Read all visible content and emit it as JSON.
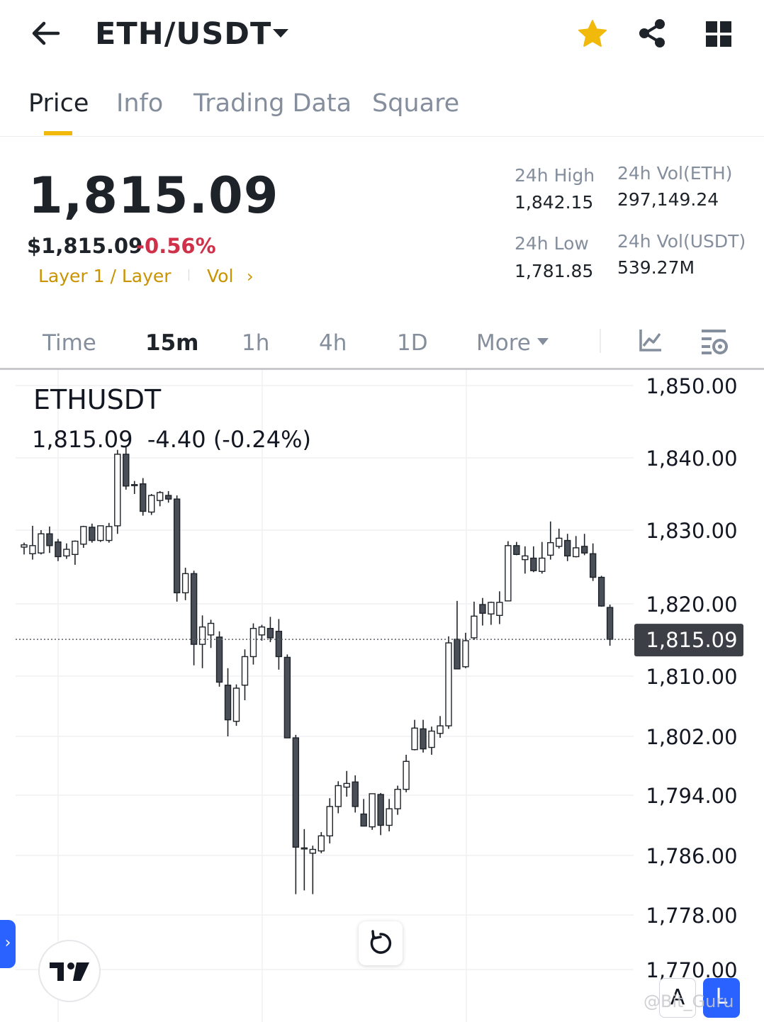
{
  "header": {
    "pair": "ETH/USDT",
    "icons": [
      "back-arrow-icon",
      "caret-down-icon",
      "star-icon",
      "share-icon",
      "grid-icon"
    ],
    "favorite_color": "#f0b90b"
  },
  "tabs": [
    {
      "label": "Price",
      "active": true
    },
    {
      "label": "Info",
      "active": false
    },
    {
      "label": "Trading Data",
      "active": false
    },
    {
      "label": "Square",
      "active": false
    }
  ],
  "ticker": {
    "last_price": "1,815.09",
    "usd_price": "$1,815.09",
    "change_pct": "-0.56%",
    "tag": "Layer 1 / Layer",
    "vol_link": "Vol",
    "vol_arrow": "›",
    "high_label": "24h High",
    "high_value": "1,842.15",
    "low_label": "24h Low",
    "low_value": "1,781.85",
    "vol_eth_label": "24h Vol(ETH)",
    "vol_eth_value": "297,149.24",
    "vol_usdt_label": "24h Vol(USDT)",
    "vol_usdt_value": "539.27M",
    "colors": {
      "down": "#cf304a",
      "accent": "#f0b90b",
      "tag": "#c99400"
    }
  },
  "intervals": [
    {
      "label": "Time",
      "active": false
    },
    {
      "label": "15m",
      "active": true
    },
    {
      "label": "1h",
      "active": false
    },
    {
      "label": "4h",
      "active": false
    },
    {
      "label": "1D",
      "active": false
    },
    {
      "label": "More",
      "active": false
    }
  ],
  "chart": {
    "symbol": "ETHUSDT",
    "quote": "1,815.09  -4.40 (-0.24%)",
    "drawer_arrow": "›",
    "auto_label": "A",
    "log_label": "L",
    "watermark": "@Bit_Guru"
  },
  "chart_data": {
    "type": "candlestick",
    "symbol": "ETHUSDT",
    "interval": "15m",
    "y_ticks": [
      "1,850.00",
      "1,840.00",
      "1,830.00",
      "1,820.00",
      "1,810.00",
      "1,802.00",
      "1,794.00",
      "1,786.00",
      "1,778.00",
      "1,770.00"
    ],
    "y_tick_values": [
      1850,
      1840,
      1830,
      1820,
      1810,
      1802,
      1794,
      1786,
      1778,
      1770
    ],
    "ylim": [
      1766,
      1851.5
    ],
    "last_price_label": "1,815.09",
    "last_price": 1815.09,
    "candles": [
      {
        "o": 1827.7,
        "h": 1828.3,
        "l": 1826.7,
        "c": 1828.0
      },
      {
        "o": 1826.8,
        "h": 1830.6,
        "l": 1826.0,
        "c": 1827.9
      },
      {
        "o": 1826.9,
        "h": 1830.0,
        "l": 1826.7,
        "c": 1829.5
      },
      {
        "o": 1829.5,
        "h": 1830.5,
        "l": 1826.9,
        "c": 1827.9
      },
      {
        "o": 1828.4,
        "h": 1828.8,
        "l": 1825.8,
        "c": 1826.4
      },
      {
        "o": 1826.5,
        "h": 1828.2,
        "l": 1826.1,
        "c": 1827.4
      },
      {
        "o": 1826.7,
        "h": 1828.6,
        "l": 1825.3,
        "c": 1828.5
      },
      {
        "o": 1828.1,
        "h": 1830.6,
        "l": 1827.6,
        "c": 1830.5
      },
      {
        "o": 1830.4,
        "h": 1830.9,
        "l": 1828.3,
        "c": 1828.6
      },
      {
        "o": 1828.6,
        "h": 1830.5,
        "l": 1828.4,
        "c": 1830.6
      },
      {
        "o": 1828.6,
        "h": 1831.0,
        "l": 1828.3,
        "c": 1830.5
      },
      {
        "o": 1830.6,
        "h": 1841.1,
        "l": 1829.5,
        "c": 1840.5
      },
      {
        "o": 1840.5,
        "h": 1841.5,
        "l": 1835.6,
        "c": 1836.1
      },
      {
        "o": 1836.2,
        "h": 1836.8,
        "l": 1835.0,
        "c": 1836.3
      },
      {
        "o": 1836.4,
        "h": 1837.2,
        "l": 1832.0,
        "c": 1832.6
      },
      {
        "o": 1832.5,
        "h": 1835.0,
        "l": 1832.1,
        "c": 1834.8
      },
      {
        "o": 1834.1,
        "h": 1835.4,
        "l": 1833.3,
        "c": 1835.2
      },
      {
        "o": 1834.8,
        "h": 1835.4,
        "l": 1833.8,
        "c": 1834.3
      },
      {
        "o": 1834.3,
        "h": 1834.8,
        "l": 1820.3,
        "c": 1821.5
      },
      {
        "o": 1821.5,
        "h": 1824.9,
        "l": 1820.5,
        "c": 1824.1
      },
      {
        "o": 1824.1,
        "h": 1824.5,
        "l": 1811.5,
        "c": 1814.4
      },
      {
        "o": 1814.4,
        "h": 1818.4,
        "l": 1811.1,
        "c": 1816.8
      },
      {
        "o": 1815.7,
        "h": 1817.8,
        "l": 1813.9,
        "c": 1817.3
      },
      {
        "o": 1815.4,
        "h": 1816.2,
        "l": 1808.6,
        "c": 1809.2
      },
      {
        "o": 1808.8,
        "h": 1811.1,
        "l": 1802.0,
        "c": 1804.2
      },
      {
        "o": 1804.0,
        "h": 1808.9,
        "l": 1803.4,
        "c": 1808.4
      },
      {
        "o": 1808.8,
        "h": 1813.7,
        "l": 1806.8,
        "c": 1812.7
      },
      {
        "o": 1812.7,
        "h": 1817.3,
        "l": 1811.6,
        "c": 1816.6
      },
      {
        "o": 1815.7,
        "h": 1817.1,
        "l": 1814.9,
        "c": 1816.8
      },
      {
        "o": 1816.6,
        "h": 1818.2,
        "l": 1814.7,
        "c": 1815.3
      },
      {
        "o": 1816.2,
        "h": 1817.9,
        "l": 1810.9,
        "c": 1812.7
      },
      {
        "o": 1812.6,
        "h": 1813.0,
        "l": 1801.8,
        "c": 1801.8
      },
      {
        "o": 1801.8,
        "h": 1802.2,
        "l": 1780.8,
        "c": 1787.1
      },
      {
        "o": 1787.0,
        "h": 1789.5,
        "l": 1781.3,
        "c": 1787.0
      },
      {
        "o": 1786.3,
        "h": 1787.3,
        "l": 1780.8,
        "c": 1786.8
      },
      {
        "o": 1786.6,
        "h": 1789.1,
        "l": 1786.3,
        "c": 1788.6
      },
      {
        "o": 1788.6,
        "h": 1793.6,
        "l": 1787.6,
        "c": 1792.5
      },
      {
        "o": 1792.5,
        "h": 1795.9,
        "l": 1791.6,
        "c": 1795.3
      },
      {
        "o": 1795.1,
        "h": 1797.3,
        "l": 1793.8,
        "c": 1795.6
      },
      {
        "o": 1795.8,
        "h": 1796.7,
        "l": 1791.7,
        "c": 1792.5
      },
      {
        "o": 1791.5,
        "h": 1793.5,
        "l": 1789.9,
        "c": 1789.9
      },
      {
        "o": 1789.8,
        "h": 1794.2,
        "l": 1789.4,
        "c": 1794.2
      },
      {
        "o": 1794.1,
        "h": 1794.3,
        "l": 1788.7,
        "c": 1790.0
      },
      {
        "o": 1790.0,
        "h": 1793.5,
        "l": 1789.2,
        "c": 1792.2
      },
      {
        "o": 1792.2,
        "h": 1795.3,
        "l": 1791.4,
        "c": 1794.8
      },
      {
        "o": 1794.8,
        "h": 1799.5,
        "l": 1794.4,
        "c": 1798.6
      },
      {
        "o": 1800.2,
        "h": 1804.2,
        "l": 1800.1,
        "c": 1803.1
      },
      {
        "o": 1803.0,
        "h": 1804.2,
        "l": 1799.8,
        "c": 1800.3
      },
      {
        "o": 1800.5,
        "h": 1803.3,
        "l": 1799.5,
        "c": 1802.7
      },
      {
        "o": 1802.4,
        "h": 1804.7,
        "l": 1801.8,
        "c": 1803.4
      },
      {
        "o": 1803.4,
        "h": 1815.5,
        "l": 1803.0,
        "c": 1814.6
      },
      {
        "o": 1815.1,
        "h": 1820.4,
        "l": 1811.6,
        "c": 1811.0
      },
      {
        "o": 1811.3,
        "h": 1816.0,
        "l": 1811.1,
        "c": 1814.9
      },
      {
        "o": 1815.3,
        "h": 1820.3,
        "l": 1815.0,
        "c": 1818.3
      },
      {
        "o": 1819.9,
        "h": 1820.8,
        "l": 1817.0,
        "c": 1818.7
      },
      {
        "o": 1818.6,
        "h": 1820.3,
        "l": 1817.1,
        "c": 1820.2
      },
      {
        "o": 1818.4,
        "h": 1821.7,
        "l": 1817.2,
        "c": 1820.2
      },
      {
        "o": 1820.4,
        "h": 1828.5,
        "l": 1820.4,
        "c": 1827.9
      },
      {
        "o": 1827.9,
        "h": 1828.4,
        "l": 1826.6,
        "c": 1826.7
      },
      {
        "o": 1826.0,
        "h": 1827.8,
        "l": 1824.1,
        "c": 1826.5
      },
      {
        "o": 1826.2,
        "h": 1827.8,
        "l": 1824.3,
        "c": 1824.5
      },
      {
        "o": 1824.4,
        "h": 1828.4,
        "l": 1824.1,
        "c": 1826.2
      },
      {
        "o": 1826.6,
        "h": 1831.2,
        "l": 1826.0,
        "c": 1828.3
      },
      {
        "o": 1827.8,
        "h": 1830.2,
        "l": 1827.5,
        "c": 1828.9
      },
      {
        "o": 1828.6,
        "h": 1829.5,
        "l": 1825.8,
        "c": 1826.5
      },
      {
        "o": 1826.4,
        "h": 1829.2,
        "l": 1826.3,
        "c": 1827.6
      },
      {
        "o": 1827.8,
        "h": 1829.5,
        "l": 1826.6,
        "c": 1826.9
      },
      {
        "o": 1826.8,
        "h": 1828.2,
        "l": 1823.1,
        "c": 1823.6
      },
      {
        "o": 1823.6,
        "h": 1823.8,
        "l": 1819.6,
        "c": 1819.7
      },
      {
        "o": 1819.5,
        "h": 1819.9,
        "l": 1814.2,
        "c": 1815.1
      }
    ],
    "colors": {
      "up": "#ffffff",
      "down": "#4a4e57",
      "wick": "#1e2329",
      "price_tag": "#3c3f46"
    }
  }
}
